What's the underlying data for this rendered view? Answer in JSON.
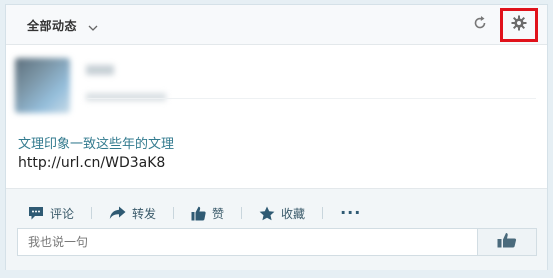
{
  "header": {
    "filter_label": "全部动态",
    "refresh_icon": "refresh-icon",
    "settings_icon": "gear-icon",
    "highlight_color": "#e0121b"
  },
  "post": {
    "link_title": "文理印象一致这些年的文理",
    "url": "http://url.cn/WD3aK8"
  },
  "actions": {
    "comment_label": "评论",
    "repost_label": "转发",
    "like_label": "赞",
    "favorite_label": "收藏",
    "more_label": "···"
  },
  "comment_box": {
    "placeholder": "我也说一句",
    "submit_icon": "thumbs-up-icon"
  },
  "colors": {
    "accent": "#337b8f",
    "icon": "#2f5a73"
  }
}
